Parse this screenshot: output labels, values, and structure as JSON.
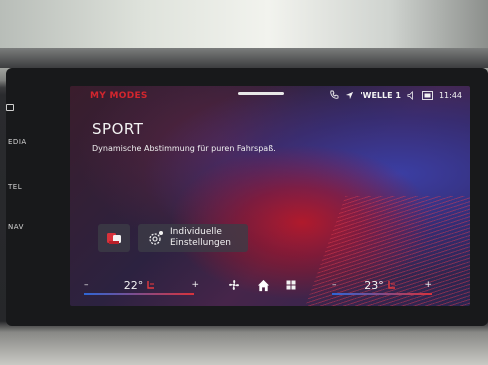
{
  "sidebar": {
    "items": [
      "EDIA",
      "TEL",
      "NAV"
    ]
  },
  "header": {
    "title": "MY MODES"
  },
  "status": {
    "station": "'WELLE 1",
    "time": "11:44"
  },
  "mode": {
    "name": "SPORT",
    "description": "Dynamische Abstimmung für puren Fahrspaß."
  },
  "settings_tile": {
    "line1": "Individuelle",
    "line2": "Einstellungen"
  },
  "climate": {
    "left_minus": "–",
    "left_temp": "22°",
    "left_plus": "+",
    "right_minus": "–",
    "right_temp": "23°",
    "right_plus": "+"
  },
  "colors": {
    "accent_red": "#d2262e",
    "accent_blue": "#2e66d6"
  },
  "icons": {
    "status": [
      "phone-icon",
      "navigation-arrow-icon",
      "volume-icon",
      "screen-icon"
    ],
    "tiles": [
      "drive-mode-icon",
      "settings-gear-icon"
    ],
    "climate": [
      "seat-heating-icon",
      "fan-icon",
      "home-icon",
      "grid-menu-icon"
    ]
  }
}
